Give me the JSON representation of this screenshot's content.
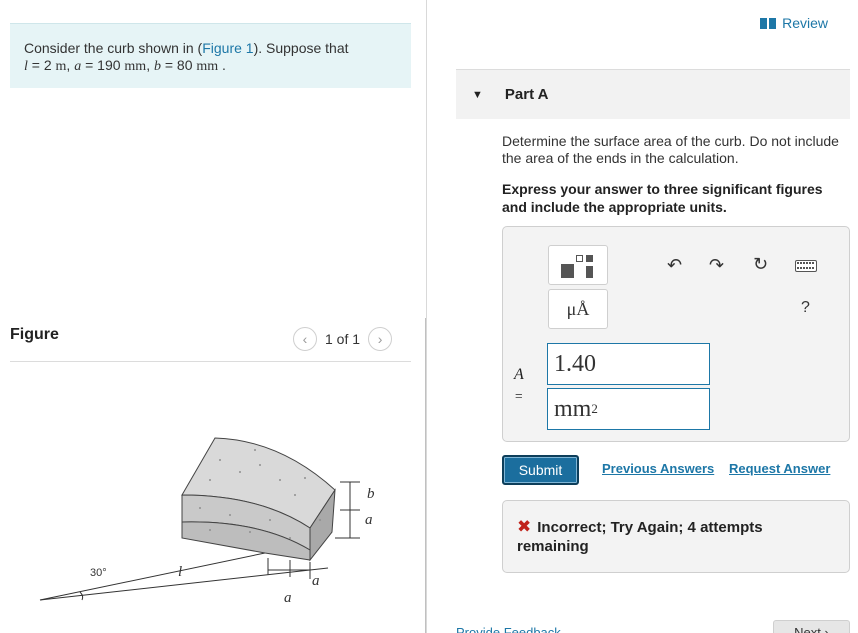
{
  "problem": {
    "prefix": "Consider the curb shown in (",
    "figure_link": "Figure 1",
    "suffix": "). Suppose that",
    "l_var": "l",
    "l_value": " = 2 ",
    "l_unit": "m",
    "a_var": "a",
    "a_value": " = 190 ",
    "a_unit": "mm",
    "b_var": "b",
    "b_value": " = 80 ",
    "b_unit": "mm"
  },
  "figure": {
    "title": "Figure",
    "pager_text": "1 of 1",
    "prev_icon": "chevron-left-icon",
    "next_icon": "chevron-right-icon",
    "labels": {
      "angle": "30°",
      "l": "l",
      "a_bottom": "a",
      "a_bottom2": "a",
      "a_side": "a",
      "b_side": "b"
    }
  },
  "review": {
    "label": "Review",
    "icon": "book-icon"
  },
  "part": {
    "label": "Part A",
    "caret_icon": "caret-down-icon"
  },
  "question": "Determine the surface area of the curb. Do not include the area of the ends in the calculation.",
  "instruction": "Express your answer to three significant figures and include the appropriate units.",
  "answer": {
    "variable": "A",
    "equals": "=",
    "value": "1.40",
    "unit_base": "mm",
    "unit_exp": "2",
    "units_button": "μÅ",
    "help": "?",
    "toolbar_icons": [
      "templates-icon",
      "units-icon",
      "undo-icon",
      "redo-icon",
      "reset-icon",
      "keyboard-icon",
      "help-icon"
    ]
  },
  "actions": {
    "submit": "Submit",
    "previous_answers": "Previous Answers",
    "request_answer": "Request Answer"
  },
  "feedback": {
    "icon": "x-icon",
    "text": "Incorrect; Try Again; 4 attempts remaining",
    "color": "#c0221a"
  },
  "footer": {
    "provide_feedback": "Provide Feedback",
    "next": "Next"
  },
  "colors": {
    "link": "#1d77a7",
    "problem_bg": "#e6f4f6",
    "submit_bg": "#1b6e9e"
  }
}
